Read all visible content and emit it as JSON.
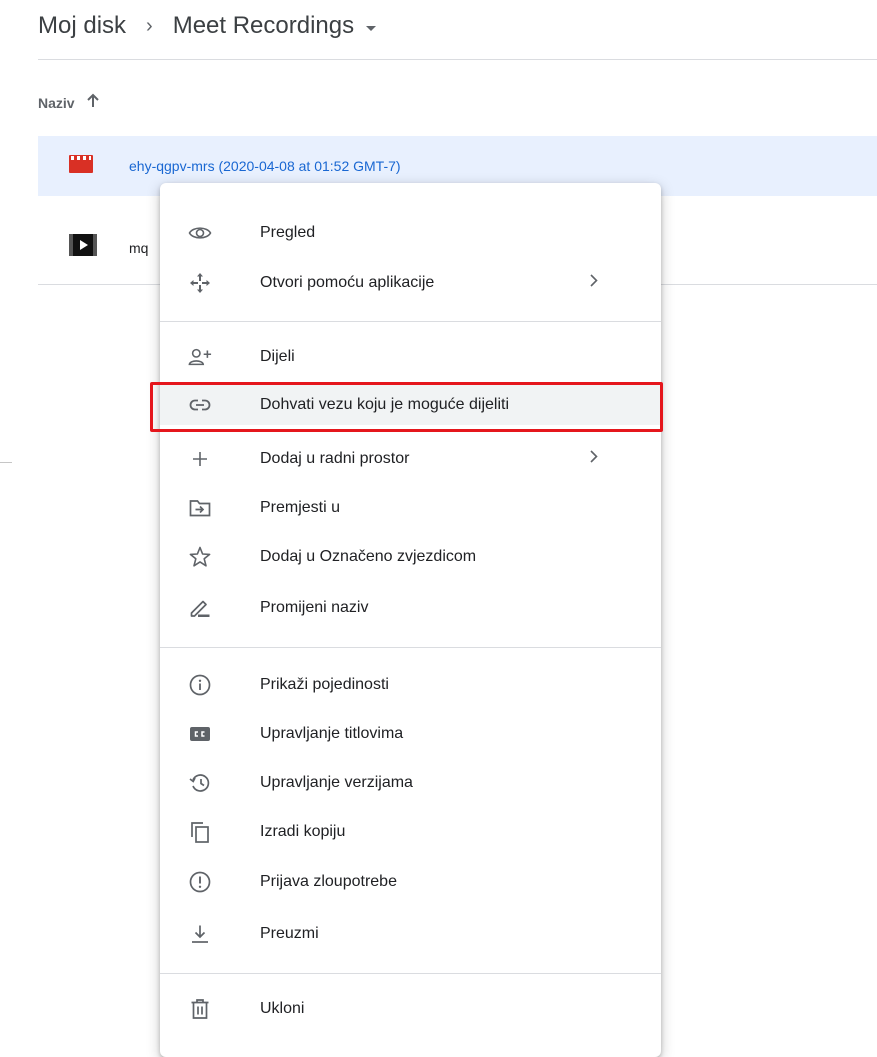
{
  "breadcrumb": {
    "root": "Moj disk",
    "separator": "›",
    "current": "Meet Recordings"
  },
  "list": {
    "column_name": "Naziv",
    "sort_direction": "ascending",
    "files": [
      {
        "name": "ehy-qgpv-mrs (2020-04-08 at 01:52 GMT-7)",
        "icon": "video-file-icon",
        "selected": true
      },
      {
        "name": "mq",
        "icon": "video-thumbnail-icon",
        "selected": false
      }
    ]
  },
  "context_menu": {
    "items": [
      {
        "label": "Pregled",
        "icon": "eye-icon"
      },
      {
        "label": "Otvori pomoću aplikacije",
        "icon": "open-with-icon",
        "submenu": true
      },
      {
        "label": "Dijeli",
        "icon": "person-add-icon"
      },
      {
        "label": "Dohvati vezu koju je moguće dijeliti",
        "icon": "link-icon",
        "highlighted": true
      },
      {
        "label": "Dodaj u radni prostor",
        "icon": "plus-icon",
        "submenu": true
      },
      {
        "label": "Premjesti u",
        "icon": "move-to-folder-icon"
      },
      {
        "label": "Dodaj u Označeno zvjezdicom",
        "icon": "star-icon"
      },
      {
        "label": "Promijeni naziv",
        "icon": "pencil-icon"
      },
      {
        "label": "Prikaži pojedinosti",
        "icon": "info-icon"
      },
      {
        "label": "Upravljanje titlovima",
        "icon": "closed-caption-icon"
      },
      {
        "label": "Upravljanje verzijama",
        "icon": "history-icon"
      },
      {
        "label": "Izradi kopiju",
        "icon": "copy-icon"
      },
      {
        "label": "Prijava zloupotrebe",
        "icon": "report-icon"
      },
      {
        "label": "Preuzmi",
        "icon": "download-icon"
      },
      {
        "label": "Ukloni",
        "icon": "trash-icon"
      }
    ]
  },
  "colors": {
    "accent": "#1967d2",
    "selected_row": "#e8f0fe",
    "highlight_box": "#e5161c",
    "video_icon": "#d93025"
  }
}
